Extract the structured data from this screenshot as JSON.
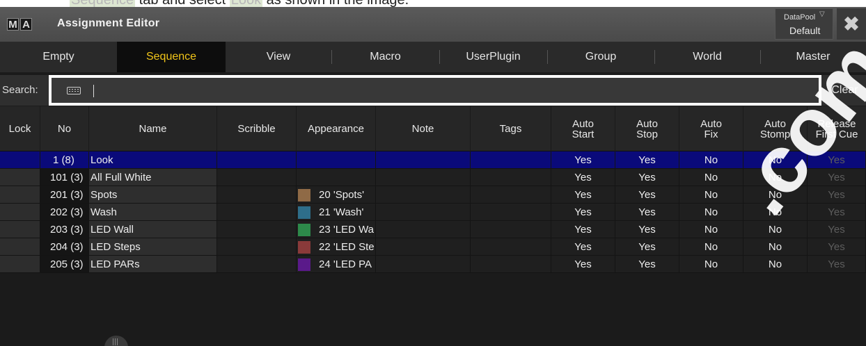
{
  "instruction": {
    "prefix": "",
    "tab_word": "Sequence",
    "middle": " tab and select ",
    "select_word": "Look",
    "suffix": " as shown in the image."
  },
  "window": {
    "logo_letters": [
      "M",
      "A"
    ],
    "title": "Assignment Editor",
    "datapool_label": "DataPool",
    "datapool_value": "Default",
    "close_glyph": "✖"
  },
  "tabs": [
    {
      "label": "Empty",
      "active": false
    },
    {
      "label": "Sequence",
      "active": true
    },
    {
      "label": "View",
      "active": false
    },
    {
      "label": "Macro",
      "active": false
    },
    {
      "label": "UserPlugin",
      "active": false
    },
    {
      "label": "Group",
      "active": false
    },
    {
      "label": "World",
      "active": false
    },
    {
      "label": "Master",
      "active": false
    }
  ],
  "search": {
    "label": "Search:",
    "value": "",
    "keyboard_icon": "keyboard-icon",
    "clear_label": "Clear"
  },
  "columns": {
    "lock": "Lock",
    "no": "No",
    "name": "Name",
    "scribble": "Scribble",
    "appearance": "Appearance",
    "note": "Note",
    "tags": "Tags",
    "auto_start": [
      "Auto",
      "Start"
    ],
    "auto_stop": [
      "Auto",
      "Stop"
    ],
    "auto_fix": [
      "Auto",
      "Fix"
    ],
    "auto_stomp": [
      "Auto",
      "Stomp"
    ],
    "release_first_cue": [
      "Release",
      "First Cue"
    ]
  },
  "rows": [
    {
      "no": "1 (8)",
      "name": "Look",
      "appearance": "",
      "swatch": "",
      "auto_start": "Yes",
      "auto_stop": "Yes",
      "auto_fix": "No",
      "auto_stomp": "No",
      "release_first_cue": "Yes",
      "selected": true
    },
    {
      "no": "101 (3)",
      "name": "All Full White",
      "appearance": "",
      "swatch": "",
      "auto_start": "Yes",
      "auto_stop": "Yes",
      "auto_fix": "No",
      "auto_stomp": "No",
      "release_first_cue": "Yes",
      "selected": false
    },
    {
      "no": "201 (3)",
      "name": "Spots",
      "appearance": "20 'Spots'",
      "swatch": "#8f6a46",
      "auto_start": "Yes",
      "auto_stop": "Yes",
      "auto_fix": "No",
      "auto_stomp": "No",
      "release_first_cue": "Yes",
      "selected": false
    },
    {
      "no": "202 (3)",
      "name": "Wash",
      "appearance": "21 'Wash'",
      "swatch": "#2e6e8a",
      "auto_start": "Yes",
      "auto_stop": "Yes",
      "auto_fix": "No",
      "auto_stomp": "No",
      "release_first_cue": "Yes",
      "selected": false
    },
    {
      "no": "203 (3)",
      "name": "LED Wall",
      "appearance": "23 'LED Wa",
      "swatch": "#2d8a4a",
      "auto_start": "Yes",
      "auto_stop": "Yes",
      "auto_fix": "No",
      "auto_stomp": "No",
      "release_first_cue": "Yes",
      "selected": false
    },
    {
      "no": "204 (3)",
      "name": "LED Steps",
      "appearance": "22 'LED Ste",
      "swatch": "#8a3a3a",
      "auto_start": "Yes",
      "auto_stop": "Yes",
      "auto_fix": "No",
      "auto_stomp": "No",
      "release_first_cue": "Yes",
      "selected": false
    },
    {
      "no": "205 (3)",
      "name": "LED PARs",
      "appearance": "24 'LED PA",
      "swatch": "#5a1a8a",
      "auto_start": "Yes",
      "auto_stop": "Yes",
      "auto_fix": "No",
      "auto_stomp": "No",
      "release_first_cue": "Yes",
      "selected": false
    }
  ],
  "watermark": ".com",
  "colors": {
    "active_tab_text": "#f0c419",
    "selected_row": "#0a0a7a",
    "search_highlight_border": "#ffffff"
  }
}
